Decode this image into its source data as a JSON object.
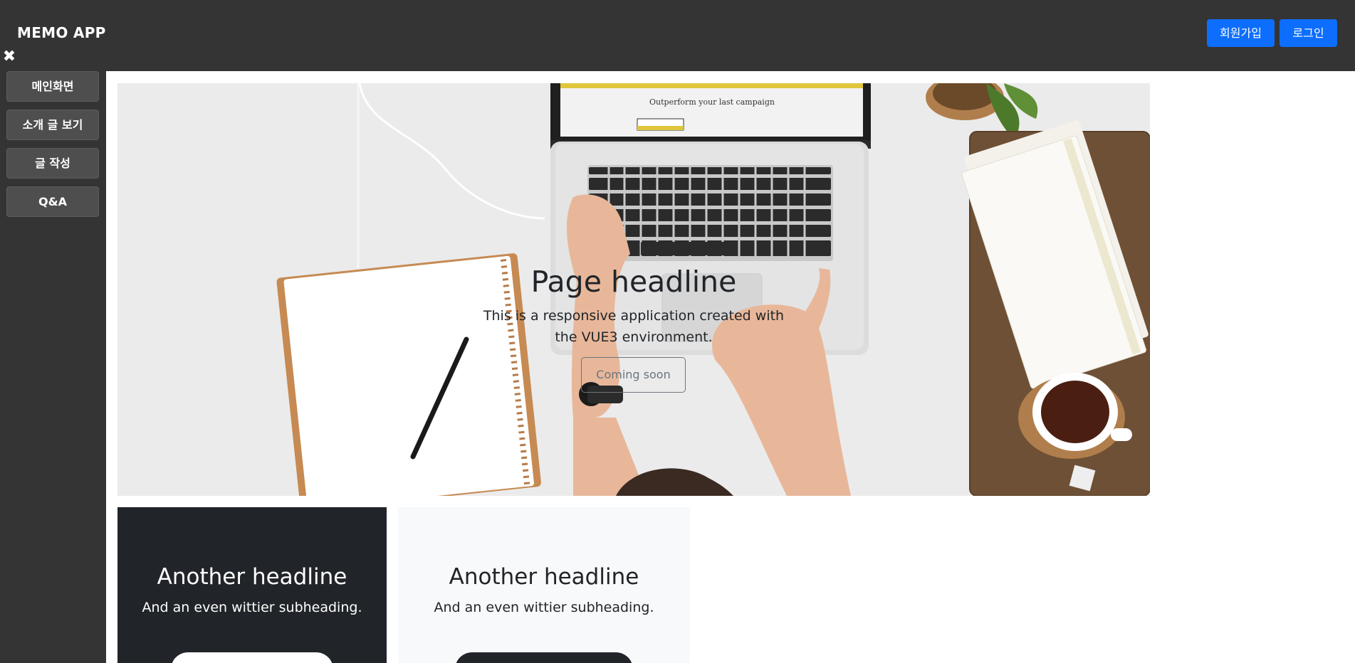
{
  "header": {
    "brand": "MEMO APP",
    "signup_label": "회원가입",
    "login_label": "로그인",
    "accent_color": "#0d6efd"
  },
  "sidebar": {
    "close_icon": "close-icon",
    "close_glyph": "✖",
    "items": [
      {
        "label": "메인화면"
      },
      {
        "label": "소개 글 보기"
      },
      {
        "label": "글 작성"
      },
      {
        "label": "Q&A"
      }
    ]
  },
  "hero": {
    "title": "Page headline",
    "subtitle": "This is a responsive application created with the VUE3 environment.",
    "button_label": "Coming soon",
    "screen_text": "Outperform your last campaign"
  },
  "cards": [
    {
      "title": "Another headline",
      "subtitle": "And an even wittier subheading."
    },
    {
      "title": "Another headline",
      "subtitle": "And an even wittier subheading."
    }
  ]
}
